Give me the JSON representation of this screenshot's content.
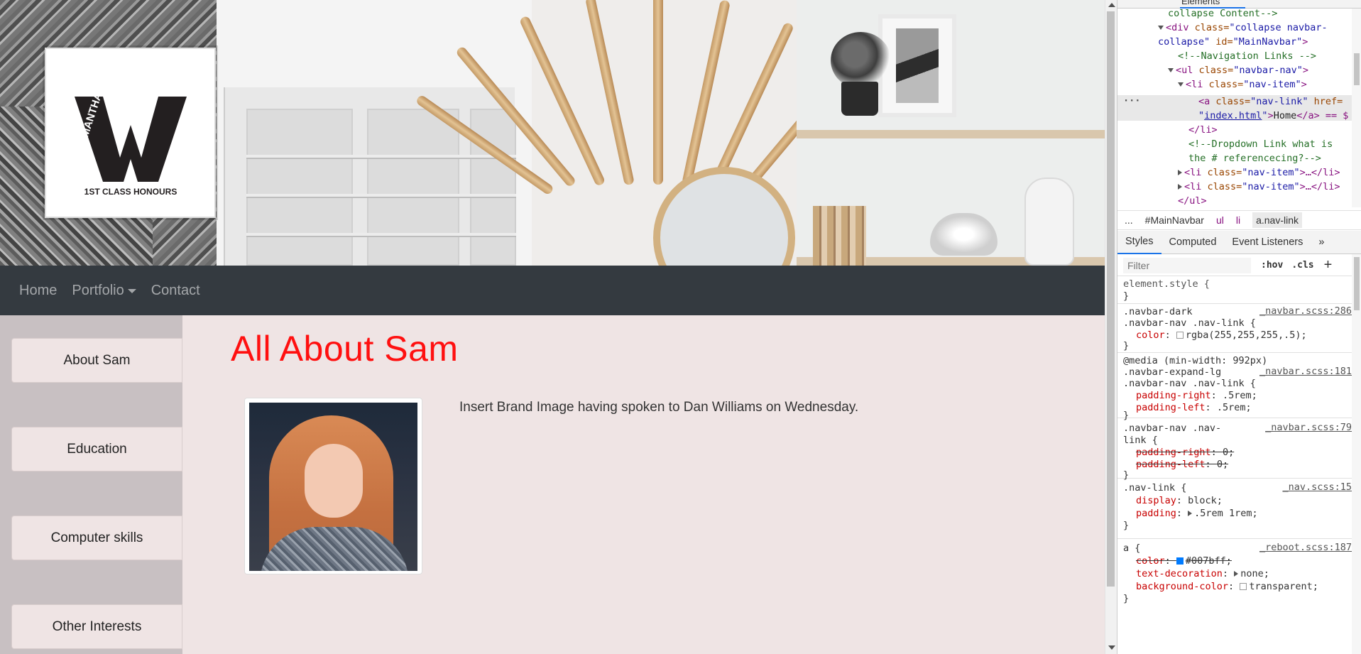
{
  "site": {
    "logo": {
      "brand_letter": "W",
      "name": "SAMANTHA",
      "tagline": "1ST CLASS HONOURS"
    },
    "navbar": {
      "items": [
        {
          "label": "Home"
        },
        {
          "label": "Portfolio"
        },
        {
          "label": "Contact"
        }
      ]
    },
    "sidebar": {
      "items": [
        {
          "label": "About Sam"
        },
        {
          "label": "Education"
        },
        {
          "label": "Computer skills"
        },
        {
          "label": "Other Interests"
        }
      ]
    },
    "main": {
      "title": "All About Sam",
      "intro": "Insert Brand Image having spoken to Dan Williams on Wednesday."
    },
    "colors": {
      "title": "#ff1010",
      "navbar_bg": "#343a40",
      "page_bg": "#efe4e4",
      "sidebar_bg": "#c8c0c2"
    }
  },
  "devtools": {
    "active_panel": "Elements",
    "dom": {
      "l1": "collapse Content-->",
      "l2_tag": "<div ",
      "l2_attr": "class=",
      "l2_val": "\"collapse navbar-",
      "l3_val": "collapse\"",
      "l3_attr": " id=",
      "l3_val2": "\"MainNavbar\"",
      "l3_end": ">",
      "l4": "<!--Navigation Links -->",
      "l5_tag": "<ul ",
      "l5_attr": "class=",
      "l5_val": "\"navbar-nav\"",
      "l5_end": ">",
      "l6_tag": "<li ",
      "l6_attr": "class=",
      "l6_val": "\"nav-item\"",
      "l6_end": ">",
      "l7_tag": "<a ",
      "l7_attr": "class=",
      "l7_val": "\"nav-link\"",
      "l7_attr2": " href=",
      "l8_link": "index.html",
      "l8_text": "Home",
      "l8_end": "</a> == $",
      "l9": "</li>",
      "l10": "<!--Dropdown Link what is",
      "l11": "the # referencecing?-->",
      "l12_tag": "<li ",
      "l12_attr": "class=",
      "l12_val": "\"nav-item\"",
      "l12_end": ">…</li>",
      "l13_tag": "<li ",
      "l13_attr": "class=",
      "l13_val": "\"nav-item\"",
      "l13_end": ">…</li>",
      "l14": "</ul>"
    },
    "breadcrumbs": [
      "...",
      "#MainNavbar",
      "ul",
      "li",
      "a.nav-link"
    ],
    "tabs": [
      "Styles",
      "Computed",
      "Event Listeners",
      "»"
    ],
    "filter": {
      "placeholder": "Filter",
      "hov": ":hov",
      "cls": ".cls",
      "plus": "+"
    },
    "rules": {
      "r1_sel": "element.style {",
      "r1_close": "}",
      "r2_sel1": ".navbar-dark",
      "r2_src": "_navbar.scss:286",
      "r2_sel2": ".navbar-nav .nav-link {",
      "r2_prop": "color",
      "r2_val": "rgba(255,255,255,.5);",
      "r2_close": "}",
      "r3_media": "@media (min-width: 992px)",
      "r3_sel1": ".navbar-expand-lg",
      "r3_src": "_navbar.scss:181",
      "r3_sel2": ".navbar-nav .nav-link {",
      "r3_p1": "padding-right",
      "r3_v1": ".5rem;",
      "r3_p2": "padding-left",
      "r3_v2": ".5rem;",
      "r3_close": "}",
      "r4_sel1": ".navbar-nav .nav-",
      "r4_src": "_navbar.scss:79",
      "r4_sel2": "link {",
      "r4_p1": "padding-right",
      "r4_v1": "0;",
      "r4_p2": "padding-left",
      "r4_v2": "0;",
      "r4_close": "}",
      "r5_sel": ".nav-link {",
      "r5_src": "_nav.scss:15",
      "r5_p1": "display",
      "r5_v1": "block;",
      "r5_p2": "padding",
      "r5_v2": ".5rem 1rem;",
      "r5_close": "}",
      "r6_sel": "a {",
      "r6_src": "_reboot.scss:187",
      "r6_p1": "color",
      "r6_v1": "#007bff;",
      "r6_p2": "text-decoration",
      "r6_v2": "none;",
      "r6_p3": "background-color",
      "r6_v3": "transparent;",
      "r6_close": "}"
    },
    "swatches": {
      "r2": "#7f7f7f",
      "r6_color": "#007bff",
      "r6_bg": "transparent"
    }
  }
}
